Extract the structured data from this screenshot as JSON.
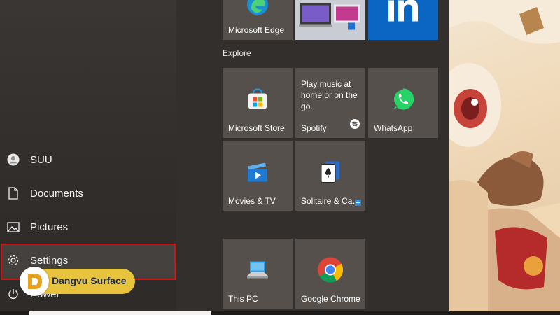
{
  "rail": {
    "user": "SUU",
    "documents": "Documents",
    "pictures": "Pictures",
    "settings": "Settings",
    "power": "Power"
  },
  "tiles": {
    "edge": "Microsoft Edge",
    "group_explore": "Explore",
    "store": "Microsoft Store",
    "spotify": "Spotify",
    "spotify_desc": "Play music at home or on the go.",
    "whatsapp": "WhatsApp",
    "movies": "Movies & TV",
    "solitaire": "Solitaire & Ca…",
    "thispc": "This PC",
    "chrome": "Google Chrome"
  },
  "watermark": {
    "text": "Dangvu Surface"
  },
  "colors": {
    "highlight_border": "#d01414",
    "linkedin": "#0a66c2",
    "whatsapp": "#25d366",
    "movies": "#1f7ad1",
    "badge": "#e8c33d"
  }
}
